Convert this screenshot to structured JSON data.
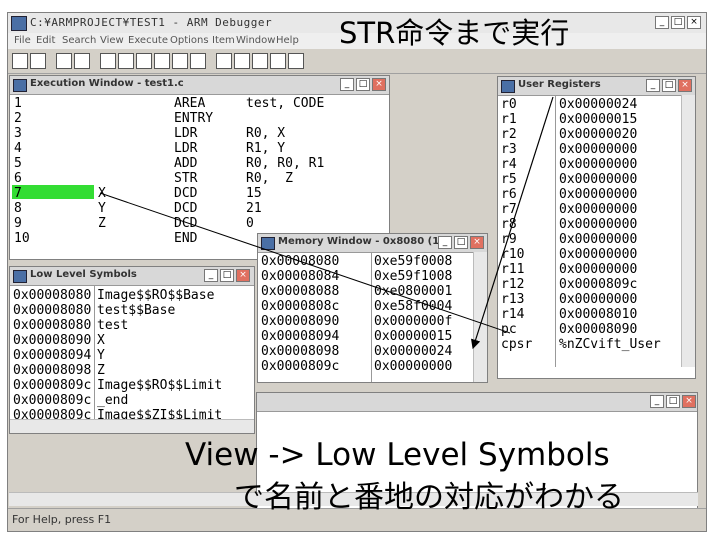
{
  "app": {
    "title": "C:¥ARMPROJECT¥TEST1 - ARM Debugger",
    "menu": [
      "File",
      "Edit",
      "Search",
      "View",
      "Execute",
      "Options",
      "Item",
      "Window",
      "Help"
    ],
    "status": "For Help, press F1"
  },
  "exec": {
    "title": "Execution Window - test1.c",
    "lines": [
      {
        "n": "1",
        "sym": "",
        "op": "AREA",
        "arg": "test, CODE"
      },
      {
        "n": "2",
        "sym": "",
        "op": "ENTRY",
        "arg": ""
      },
      {
        "n": "3",
        "sym": "",
        "op": "LDR",
        "arg": "R0, X"
      },
      {
        "n": "4",
        "sym": "",
        "op": "LDR",
        "arg": "R1, Y"
      },
      {
        "n": "5",
        "sym": "",
        "op": "ADD",
        "arg": "R0, R0, R1"
      },
      {
        "n": "6",
        "sym": "",
        "op": "STR",
        "arg": "R0,  Z"
      },
      {
        "n": "7",
        "sym": "X",
        "op": "DCD",
        "arg": "15"
      },
      {
        "n": "8",
        "sym": "Y",
        "op": "DCD",
        "arg": "21"
      },
      {
        "n": "9",
        "sym": "Z",
        "op": "DCD",
        "arg": "0"
      },
      {
        "n": "10",
        "sym": "",
        "op": "END",
        "arg": ""
      }
    ]
  },
  "regs": {
    "title": "User Registers",
    "rows": [
      [
        "r0",
        "0x00000024"
      ],
      [
        "r1",
        "0x00000015"
      ],
      [
        "r2",
        "0x00000020"
      ],
      [
        "r3",
        "0x00000000"
      ],
      [
        "r4",
        "0x00000000"
      ],
      [
        "r5",
        "0x00000000"
      ],
      [
        "r6",
        "0x00000000"
      ],
      [
        "r7",
        "0x00000000"
      ],
      [
        "r8",
        "0x00000000"
      ],
      [
        "r9",
        "0x00000000"
      ],
      [
        "r10",
        "0x00000000"
      ],
      [
        "r11",
        "0x00000000"
      ],
      [
        "r12",
        "0x0000809c"
      ],
      [
        "r13",
        "0x00000000"
      ],
      [
        "r14",
        "0x00008010"
      ],
      [
        "pc",
        "0x00008090"
      ],
      [
        "cpsr",
        "%nZCvift_User"
      ]
    ]
  },
  "mem": {
    "title": "Memory Window - 0x8080 (1)",
    "rows": [
      [
        "0x00008080",
        "0xe59f0008"
      ],
      [
        "0x00008084",
        "0xe59f1008"
      ],
      [
        "0x00008088",
        "0xe0800001"
      ],
      [
        "0x0000808c",
        "0xe58f0004"
      ],
      [
        "0x00008090",
        "0x0000000f"
      ],
      [
        "0x00008094",
        "0x00000015"
      ],
      [
        "0x00008098",
        "0x00000024"
      ],
      [
        "0x0000809c",
        "0x00000000"
      ]
    ]
  },
  "symbols": {
    "title": "Low Level Symbols",
    "rows": [
      [
        "0x00008080",
        "Image$$RO$$Base"
      ],
      [
        "0x00008080",
        "test$$Base"
      ],
      [
        "0x00008080",
        "test"
      ],
      [
        "0x00008090",
        "X"
      ],
      [
        "0x00008094",
        "Y"
      ],
      [
        "0x00008098",
        "Z"
      ],
      [
        "0x0000809c",
        "Image$$RO$$Limit"
      ],
      [
        "0x0000809c",
        "_end"
      ],
      [
        "0x0000809c",
        "Image$$ZI$$Limit"
      ]
    ]
  },
  "annotations": {
    "top": "STR命令まで実行",
    "bottom1": "View -> Low Level Symbols",
    "bottom2": "で名前と番地の対応がわかる"
  },
  "colors": {
    "highlight": "#33dd33",
    "arrow": "#000000"
  }
}
